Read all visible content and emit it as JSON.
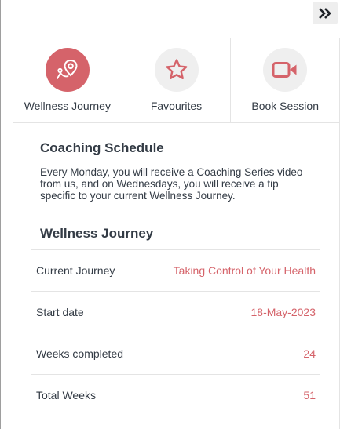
{
  "header": {
    "collapse_icon": "double-chevron-right-icon",
    "collapse_glyph": "»"
  },
  "tabs": [
    {
      "label": "Wellness Journey",
      "icon": "route-map-pin-icon",
      "active": true
    },
    {
      "label": "Favourites",
      "icon": "star-icon",
      "active": false
    },
    {
      "label": "Book Session",
      "icon": "video-camera-icon",
      "active": false
    }
  ],
  "schedule": {
    "title": "Coaching Schedule",
    "text": "Every Monday, you will receive a Coaching Series video from us, and on Wednesdays, you will receive a tip specific to your current Wellness Journey."
  },
  "journey": {
    "title": "Wellness Journey",
    "rows": [
      {
        "label": "Current Journey",
        "value": "Taking Control of Your Health"
      },
      {
        "label": "Start date",
        "value": "18-May-2023"
      },
      {
        "label": "Weeks completed",
        "value": "24"
      },
      {
        "label": "Total Weeks",
        "value": "51"
      }
    ]
  },
  "colors": {
    "accent": "#d5636a",
    "text": "#333b45",
    "divider": "#e4e4e4",
    "icon_bg": "#efefef"
  }
}
